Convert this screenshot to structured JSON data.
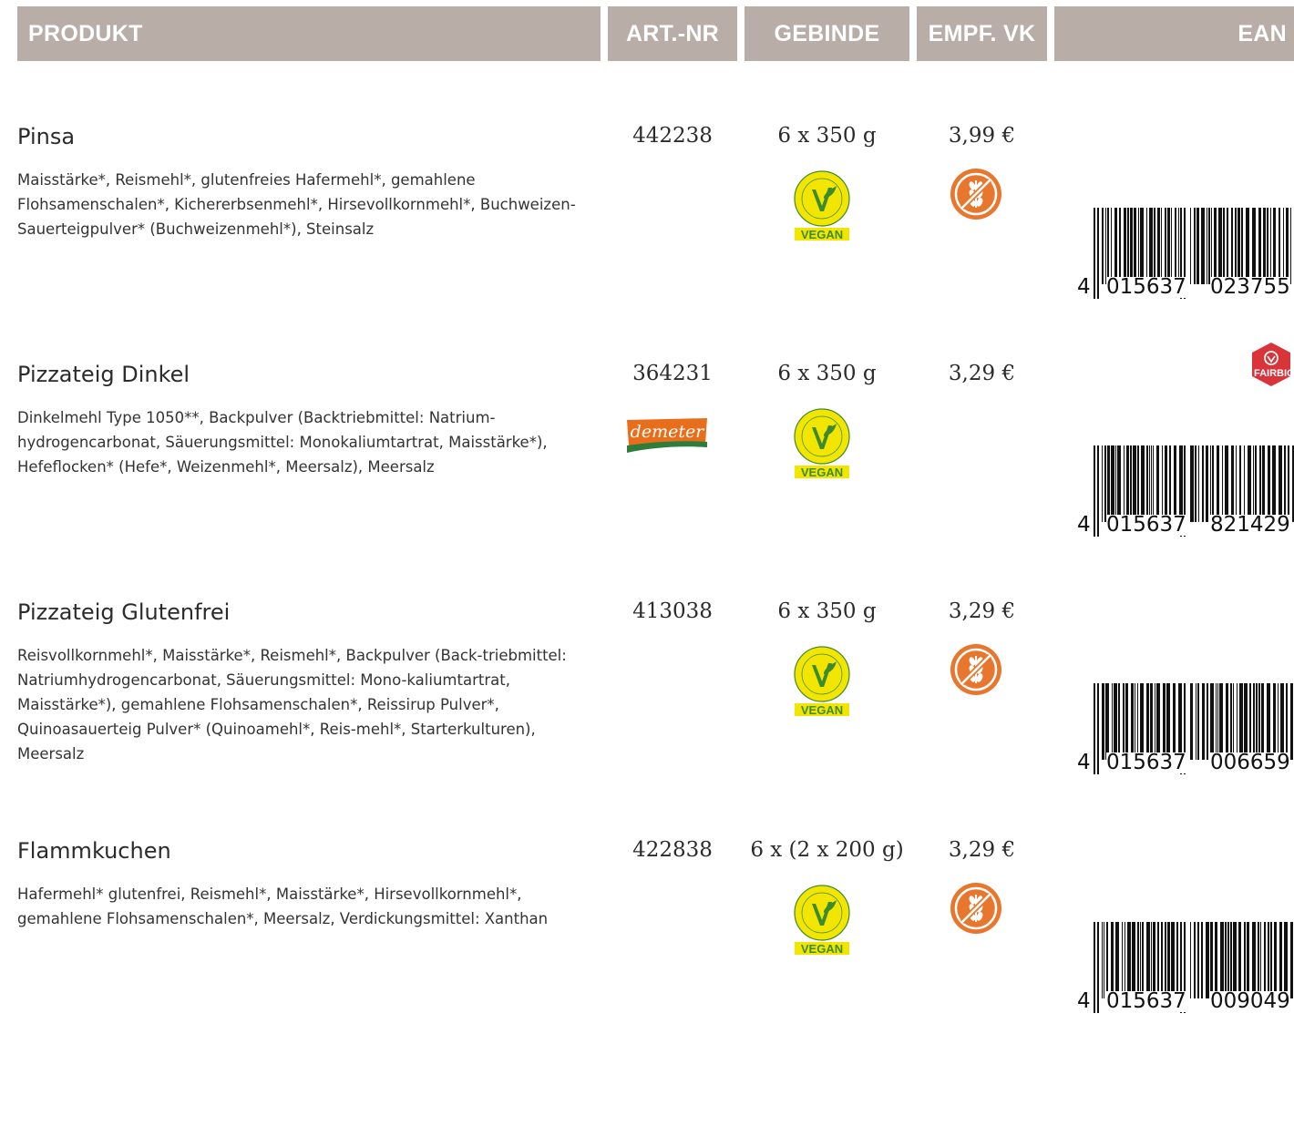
{
  "header": {
    "produkt": "PRODUKT",
    "art_nr": "ART.-NR",
    "gebinde": "GEBINDE",
    "empf_vk": "EMPF. VK",
    "ean": "EAN"
  },
  "products": [
    {
      "name": "Pinsa",
      "ingredients": "Maisstärke*, Reismehl*, glutenfreies Hafermehl*, gemahlene Flohsamenschalen*, Kichererbsenmehl*, Hirsevollkornmehl*, Buchweizen-Sauerteigpulver* (Buchweizenmehl*), Steinsalz",
      "art_nr": "442238",
      "gebinde": "6 x 350 g",
      "price": "3,99 €",
      "vegan_label": "VEGAN",
      "ean_first": "4",
      "ean_left": "015637",
      "ean_right": "023755"
    },
    {
      "name": "Pizzateig Dinkel",
      "ingredients": "Dinkelmehl Type 1050**, Backpulver (Backtriebmittel: Natrium-hydrogencarbonat, Säuerungsmittel:  Monokaliumtartrat, Maisstärke*), Hefeflocken* (Hefe*, Weizenmehl*, Meersalz), Meersalz",
      "art_nr": "364231",
      "gebinde": "6 x 350 g",
      "price": "3,29 €",
      "vegan_label": "VEGAN",
      "demeter_label": "demeter",
      "fairbio_label": "FAIRBIO",
      "ean_first": "4",
      "ean_left": "015637",
      "ean_right": "821429"
    },
    {
      "name": "Pizzateig Glutenfrei",
      "ingredients": "Reisvollkornmehl*, Maisstärke*, Reismehl*, Backpulver (Back-triebmittel: Natriumhydrogencarbonat, Säuerungsmittel: Mono-kaliumtartrat, Maisstärke*), gemahlene Flohsamenschalen*, Reissirup Pulver*, Quinoasauerteig Pulver* (Quinoamehl*, Reis-mehl*, Starterkulturen), Meersalz",
      "art_nr": "413038",
      "gebinde": "6 x 350 g",
      "price": "3,29 €",
      "vegan_label": "VEGAN",
      "ean_first": "4",
      "ean_left": "015637",
      "ean_right": "006659"
    },
    {
      "name": "Flammkuchen",
      "ingredients": "Hafermehl* glutenfrei, Reismehl*, Maisstärke*, Hirsevollkornmehl*, gemahlene Flohsamenschalen*, Meersalz, Verdickungsmittel: Xanthan",
      "art_nr": "422838",
      "gebinde": "6 x (2 x 200 g)",
      "price": "3,29 €",
      "vegan_label": "VEGAN",
      "ean_first": "4",
      "ean_left": "015637",
      "ean_right": "009049"
    }
  ],
  "colors": {
    "header_bg": "#b8ada7",
    "gluten_free_orange": "#e8762c",
    "vegan_yellow": "#f2e500",
    "vegan_green": "#3d8b2e",
    "demeter_orange": "#e86e1c",
    "demeter_green": "#2f7d3a",
    "fairbio_red": "#d9343a"
  }
}
